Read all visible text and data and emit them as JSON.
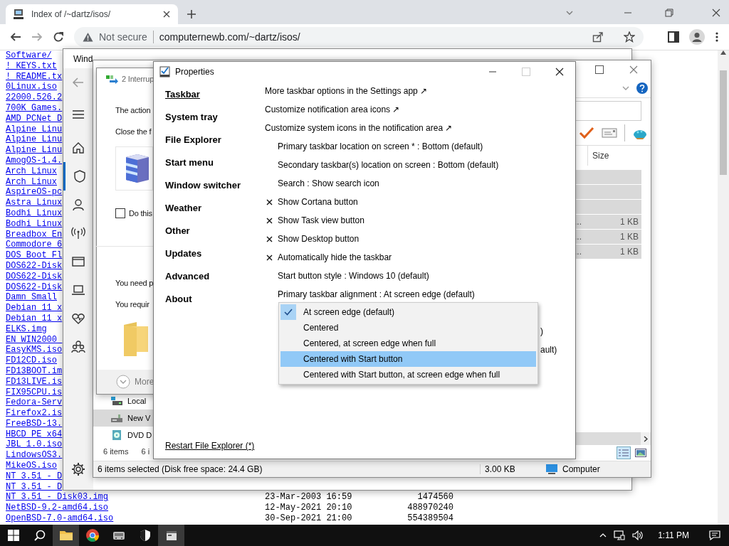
{
  "browser": {
    "tab_title": "Index of /~dartz/isos/",
    "security_label": "Not secure",
    "url": "computernewb.com/~dartz/isos/"
  },
  "listing": {
    "cut_rows": [
      "Software/",
      "! KEYS.txt",
      "! README.tx",
      "0Linux.iso",
      "22000.526.2",
      "700K Games.",
      "AMD PCNet D",
      "Alpine Linu",
      "Alpine Linu",
      "Alpine Linu",
      "AmogOS-1.4.",
      "Arch Linux",
      "Arch Linux",
      "AspireOS-pc",
      "Astra Linux",
      "Bodhi Linux",
      "Bodhi Linux",
      "Breadbox En",
      "Commodore_6",
      "DOS Boot Fl",
      "DOS622-Disk",
      "DOS622-Disk",
      "DOS622-Disk",
      "Damn Small",
      "Debian 11 x",
      "Debian 11 x",
      "ELKS.img",
      "EN_WIN2000_",
      "EasyKMS.iso",
      "FD12CD.iso",
      "FD13BOOT.im",
      "FD13LIVE.is",
      "FIX95CPU.is",
      "Fedora-Serv",
      "Firefox2.is",
      "FreeBSD-13.",
      "HBCD_PE_x64",
      "JBL_1.0.iso",
      "LindowsOS3.",
      "MikeOS.iso",
      "NT 3.51 - D",
      "NT 3.51 - D"
    ],
    "rows": [
      {
        "name": "NT 3.51 - Disk03.img",
        "date": "23-Mar-2003 16:59",
        "size": "1474560"
      },
      {
        "name": "NetBSD-9.2-amd64.iso",
        "date": "12-May-2021 20:10",
        "size": "488970240"
      },
      {
        "name": "OpenBSD-7.0-amd64.iso",
        "date": "30-Sep-2021 21:00",
        "size": "554389504"
      }
    ]
  },
  "security": {
    "title": "Wind",
    "nav": [
      {
        "kind": "back",
        "selected": false
      },
      {
        "kind": "menu",
        "selected": false
      },
      {
        "kind": "home",
        "selected": false
      },
      {
        "kind": "shield",
        "selected": true
      },
      {
        "kind": "person",
        "selected": false
      },
      {
        "kind": "antenna",
        "selected": false
      },
      {
        "kind": "window",
        "selected": false
      },
      {
        "kind": "laptop",
        "selected": false
      },
      {
        "kind": "heart",
        "selected": false
      },
      {
        "kind": "family",
        "selected": false
      },
      {
        "kind": "gear",
        "selected": false
      }
    ]
  },
  "explorer": {
    "nav_items": [
      {
        "kind": "drive",
        "label": "Local",
        "selected": false
      },
      {
        "kind": "network",
        "label": "New V",
        "selected": true
      },
      {
        "kind": "dvd",
        "label": "DVD D",
        "selected": false
      }
    ],
    "item_counts": [
      "6 items",
      "6 i"
    ],
    "size_header": "Size",
    "rows": [
      {
        "selected": true
      },
      {
        "selected": true
      },
      {
        "selected": true
      },
      {
        "name": "...",
        "size": "1 KB",
        "selected": true
      },
      {
        "name": "...",
        "size": "1 KB",
        "selected": true
      },
      {
        "name": "...",
        "size": "1 KB",
        "selected": true
      }
    ],
    "status": "6 items selected (Disk free space: 24.4 GB)",
    "status_size": "3.00 KB",
    "status_location": "Computer"
  },
  "dialog": {
    "title": "2 Interrup",
    "lines": [
      "The action",
      "Close the f"
    ],
    "checkbox": {
      "label": "Do this",
      "checked": false
    },
    "lines_2": [
      "You need p",
      "You requir"
    ],
    "more": "More"
  },
  "properties": {
    "title": "Properties",
    "tabs": [
      {
        "label": "Taskbar",
        "selected": true
      },
      {
        "label": "System tray",
        "selected": false
      },
      {
        "label": "File Explorer",
        "selected": false
      },
      {
        "label": "Start menu",
        "selected": false
      },
      {
        "label": "Window switcher",
        "selected": false
      },
      {
        "label": "Weather",
        "selected": false
      },
      {
        "label": "Other",
        "selected": false
      },
      {
        "label": "Updates",
        "selected": false
      },
      {
        "label": "Advanced",
        "selected": false
      },
      {
        "label": "About",
        "selected": false
      }
    ],
    "settings": [
      {
        "kind": "link",
        "label": "More taskbar options in the Settings app ↗"
      },
      {
        "kind": "link",
        "label": "Customize notification area icons ↗"
      },
      {
        "kind": "link",
        "label": "Customize system icons in the notification area ↗"
      },
      {
        "kind": "option",
        "label": "Primary taskbar location on screen * : Bottom (default)",
        "checked": false
      },
      {
        "kind": "option",
        "label": "Secondary taskbar(s) location on screen : Bottom (default)",
        "checked": false
      },
      {
        "kind": "option",
        "label": "Search : Show search icon",
        "checked": false
      },
      {
        "kind": "option",
        "label": "Show Cortana button",
        "checked": true
      },
      {
        "kind": "option",
        "label": "Show Task view button",
        "checked": true
      },
      {
        "kind": "option",
        "label": "Show Desktop button",
        "checked": true
      },
      {
        "kind": "option",
        "label": "Automatically hide the taskbar",
        "checked": true
      },
      {
        "kind": "option",
        "label": "Start button style : Windows 10 (default)",
        "checked": false
      },
      {
        "kind": "option",
        "label": "Primary taskbar alignment : At screen edge (default)",
        "checked": false
      }
    ],
    "covered_tails": [
      ")",
      "ault)"
    ],
    "dropdown": [
      {
        "label": "At screen edge (default)",
        "checked": true,
        "selected": false
      },
      {
        "label": "Centered",
        "checked": false,
        "selected": false
      },
      {
        "label": "Centered, at screen edge when full",
        "checked": false,
        "selected": false
      },
      {
        "label": "Centered with Start button",
        "checked": false,
        "selected": true
      },
      {
        "label": "Centered with Start button, at screen edge when full",
        "checked": false,
        "selected": false
      }
    ],
    "restart_link": "Restart File Explorer (*)"
  },
  "taskbar": {
    "apps": [
      {
        "kind": "folder",
        "open": true
      },
      {
        "kind": "browser",
        "open": false
      },
      {
        "kind": "drive",
        "open": false
      },
      {
        "kind": "shield",
        "open": false
      },
      {
        "kind": "window",
        "open": true
      }
    ],
    "clock": "1:11 PM"
  }
}
